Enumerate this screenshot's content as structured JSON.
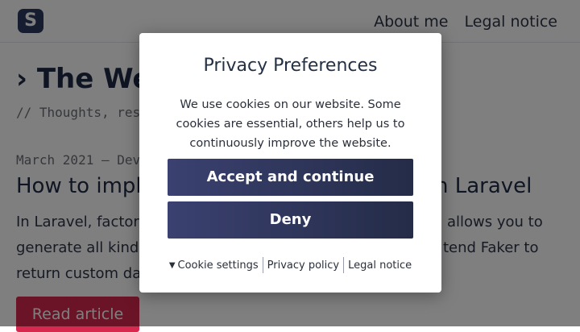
{
  "header": {
    "logo_letter": "S",
    "nav": [
      "About me",
      "Legal notice"
    ]
  },
  "page": {
    "title": "› The Web",
    "tagline": "// Thoughts, reso",
    "post_meta": "March 2021 — Deve",
    "post_title_left": "How to imple",
    "post_title_right": "n Laravel",
    "excerpt_lines": [
      [
        "In Laravel, factorie",
        "allows you to"
      ],
      [
        "generate all kinds",
        "tend Faker to"
      ],
      [
        "return custom data",
        ""
      ]
    ],
    "read_button": "Read article"
  },
  "modal": {
    "title": "Privacy Preferences",
    "text": "We use cookies on our website. Some cookies are essential, others help us to continuously improve the website.",
    "accept_label": "Accept and continue",
    "deny_label": "Deny",
    "links": {
      "cookie_settings": "Cookie settings",
      "privacy_policy": "Privacy policy",
      "legal_notice": "Legal notice"
    }
  },
  "colors": {
    "accent_red": "#d7284e",
    "button_navy": "#2f3b63"
  }
}
